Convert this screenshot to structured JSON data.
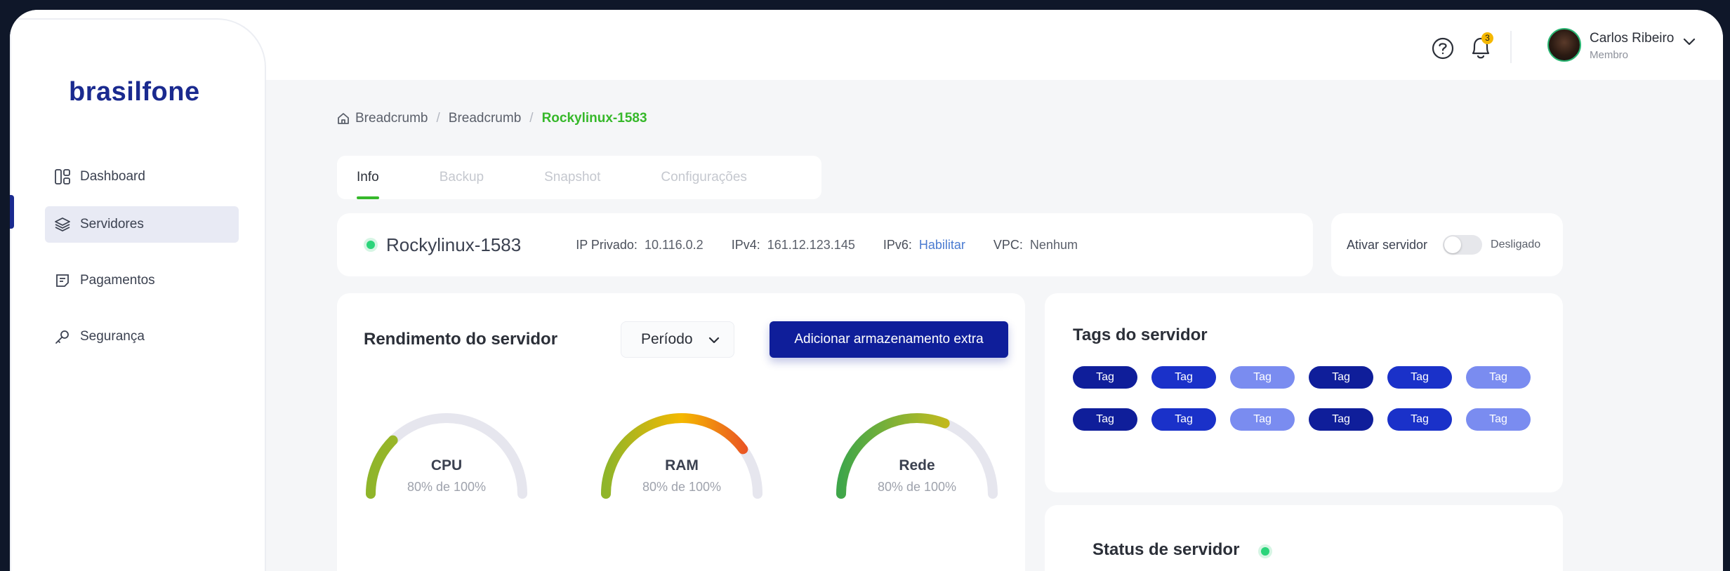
{
  "brand": {
    "logo": "brasilfone"
  },
  "sidebar": {
    "items": [
      {
        "label": "Dashboard",
        "icon": "dashboard-icon",
        "active": false
      },
      {
        "label": "Servidores",
        "icon": "layers-icon",
        "active": true
      },
      {
        "label": "Pagamentos",
        "icon": "payments-icon",
        "active": false
      },
      {
        "label": "Segurança",
        "icon": "key-icon",
        "active": false
      }
    ]
  },
  "header": {
    "notifications_count": "3",
    "user": {
      "name": "Carlos Ribeiro",
      "role": "Membro"
    }
  },
  "breadcrumb": {
    "items": [
      "Breadcrumb",
      "Breadcrumb"
    ],
    "current": "Rockylinux-1583"
  },
  "tabs": [
    {
      "label": "Info",
      "active": true
    },
    {
      "label": "Backup",
      "active": false
    },
    {
      "label": "Snapshot",
      "active": false
    },
    {
      "label": "Configurações",
      "active": false
    }
  ],
  "server": {
    "name": "Rockylinux-1583",
    "ip_private_label": "IP Privado:",
    "ip_private": "10.116.0.2",
    "ipv4_label": "IPv4:",
    "ipv4": "161.12.123.145",
    "ipv6_label": "IPv6:",
    "ipv6": "Habilitar",
    "vpc_label": "VPC:",
    "vpc": "Nenhum"
  },
  "activate": {
    "label": "Ativar servidor",
    "state": "Desligado",
    "on": false
  },
  "performance": {
    "title": "Rendimento do servidor",
    "period_label": "Período",
    "add_storage_label": "Adicionar armazenamento extra",
    "gauges": [
      {
        "name": "CPU",
        "caption": "80% de 100%",
        "fill_fraction": 0.25
      },
      {
        "name": "RAM",
        "caption": "80% de 100%",
        "fill_fraction": 0.8
      },
      {
        "name": "Rede",
        "caption": "80% de 100%",
        "fill_fraction": 0.62
      }
    ]
  },
  "tags_card": {
    "title": "Tags do servidor",
    "tags": [
      "Tag",
      "Tag",
      "Tag",
      "Tag",
      "Tag",
      "Tag",
      "Tag",
      "Tag",
      "Tag",
      "Tag",
      "Tag",
      "Tag"
    ]
  },
  "status_card": {
    "title": "Status de servidor"
  },
  "colors": {
    "brand": "#1a2a8f",
    "accent_green": "#36b82a",
    "primary_button": "#0f1e9a"
  }
}
